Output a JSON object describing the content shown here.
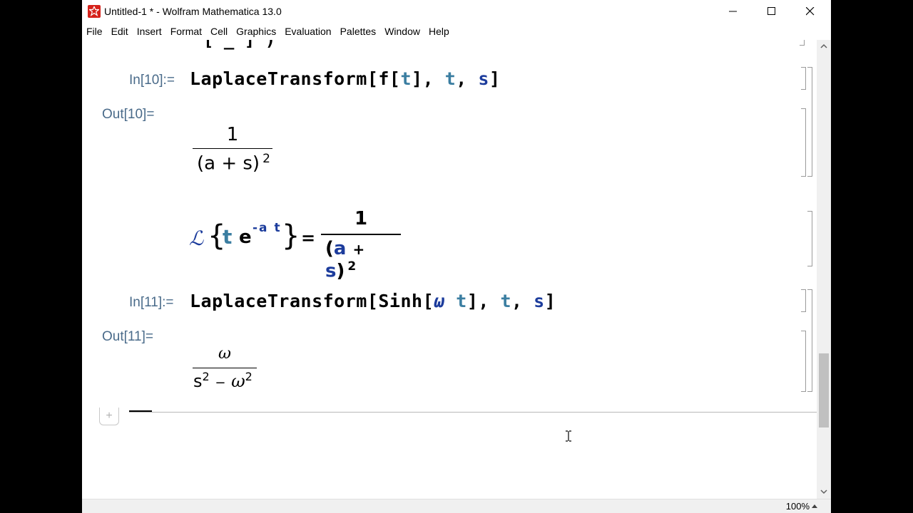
{
  "window": {
    "title": "Untitled-1 * - Wolfram Mathematica 13.0",
    "menu": [
      "File",
      "Edit",
      "Insert",
      "Format",
      "Cell",
      "Graphics",
      "Evaluation",
      "Palettes",
      "Window",
      "Help"
    ]
  },
  "cells": {
    "clipped": {
      "text": "[ _ ]    )"
    },
    "in10": {
      "label": "In[10]:=",
      "code_prefix": "LaplaceTransform[f[",
      "arg1": "t",
      "mid": "], ",
      "arg2": "t",
      "comma": ", ",
      "arg3": "s",
      "end": "]"
    },
    "out10": {
      "label": "Out[10]=",
      "numerator": "1",
      "denominator": "(a + s)",
      "exponent": "2"
    },
    "text_cell": {
      "laplace": "ℒ",
      "open_brace": "{",
      "t": "t",
      "e": "e",
      "exponent": "-a t",
      "close_brace": "}",
      "equals": "=",
      "numerator": "1",
      "den_open": "(",
      "den_a": "a",
      "den_plus": "+",
      "den_s": "s",
      "den_close": ")",
      "den_exp": "2"
    },
    "in11": {
      "label": "In[11]:=",
      "code_prefix": "LaplaceTransform[Sinh[",
      "omega": "ω",
      "t": "t",
      "mid": "], ",
      "arg2": "t",
      "comma": ", ",
      "arg3": "s",
      "end": "]"
    },
    "out11": {
      "label": "Out[11]=",
      "numerator": "ω",
      "den_s": "s",
      "den_s_exp": "2",
      "den_minus": "−",
      "den_omega": "ω",
      "den_omega_exp": "2"
    }
  },
  "status": {
    "zoom": "100%"
  },
  "insert_plus": "+",
  "colors": {
    "label": "#4a6b8a",
    "var": "#3b7ea1",
    "var_dark": "#1c3c9c",
    "app_icon": "#d6221b"
  }
}
